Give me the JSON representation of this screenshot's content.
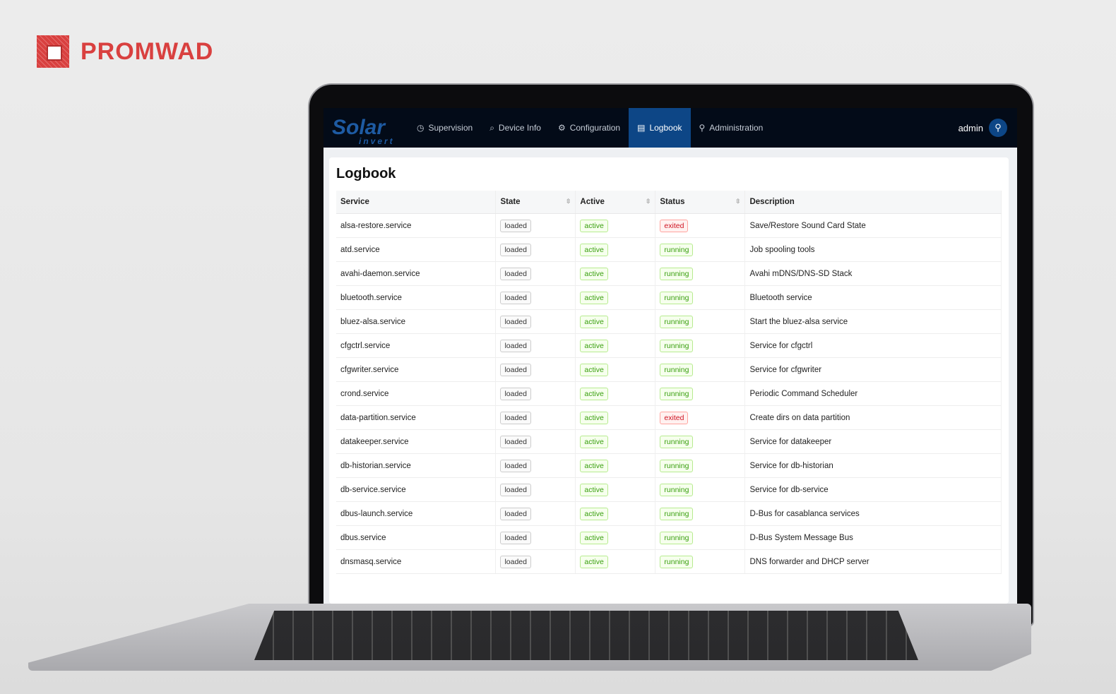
{
  "brand": {
    "name": "PROMWAD",
    "color": "#d9403f"
  },
  "app": {
    "logo_main": "Solar",
    "logo_sub": "invert",
    "accent": "#0d4686"
  },
  "nav": [
    {
      "label": "Supervision",
      "icon": "dashboard-icon",
      "glyph": "◷"
    },
    {
      "label": "Device Info",
      "icon": "search-icon",
      "glyph": "⌕"
    },
    {
      "label": "Configuration",
      "icon": "gear-icon",
      "glyph": "⚙"
    },
    {
      "label": "Logbook",
      "icon": "list-icon",
      "glyph": "▤",
      "active": true
    },
    {
      "label": "Administration",
      "icon": "user-icon",
      "glyph": "⚲"
    }
  ],
  "user": {
    "name": "admin"
  },
  "page": {
    "title": "Logbook"
  },
  "table": {
    "columns": [
      "Service",
      "State",
      "Active",
      "Status",
      "Description"
    ],
    "rows": [
      [
        "alsa-restore.service",
        "loaded",
        "active",
        "exited",
        "Save/Restore Sound Card State"
      ],
      [
        "atd.service",
        "loaded",
        "active",
        "running",
        "Job spooling tools"
      ],
      [
        "avahi-daemon.service",
        "loaded",
        "active",
        "running",
        "Avahi mDNS/DNS-SD Stack"
      ],
      [
        "bluetooth.service",
        "loaded",
        "active",
        "running",
        "Bluetooth service"
      ],
      [
        "bluez-alsa.service",
        "loaded",
        "active",
        "running",
        "Start the bluez-alsa service"
      ],
      [
        "cfgctrl.service",
        "loaded",
        "active",
        "running",
        "Service for cfgctrl"
      ],
      [
        "cfgwriter.service",
        "loaded",
        "active",
        "running",
        "Service for cfgwriter"
      ],
      [
        "crond.service",
        "loaded",
        "active",
        "running",
        "Periodic Command Scheduler"
      ],
      [
        "data-partition.service",
        "loaded",
        "active",
        "exited",
        "Create dirs on data partition"
      ],
      [
        "datakeeper.service",
        "loaded",
        "active",
        "running",
        "Service for datakeeper"
      ],
      [
        "db-historian.service",
        "loaded",
        "active",
        "running",
        "Service for db-historian"
      ],
      [
        "db-service.service",
        "loaded",
        "active",
        "running",
        "Service for db-service"
      ],
      [
        "dbus-launch.service",
        "loaded",
        "active",
        "running",
        "D-Bus for casablanca services"
      ],
      [
        "dbus.service",
        "loaded",
        "active",
        "running",
        "D-Bus System Message Bus"
      ],
      [
        "dnsmasq.service",
        "loaded",
        "active",
        "running",
        "DNS forwarder and DHCP server"
      ]
    ]
  }
}
